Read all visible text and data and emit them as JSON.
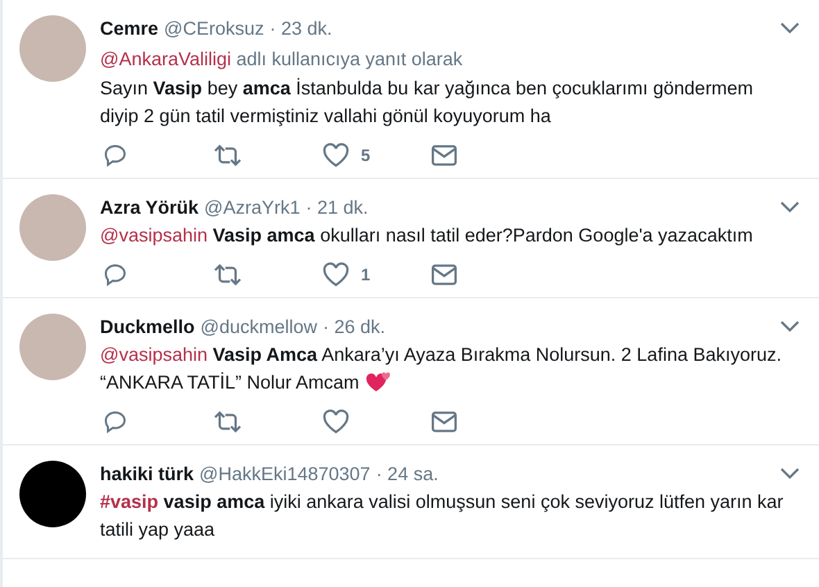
{
  "tweets": [
    {
      "name": "Cemre",
      "handle": "@CEroksuz",
      "time": "· 23 dk.",
      "reply_to": {
        "mention": "@AnkaraValiligi",
        "text": "adlı kullanıcıya yanıt olarak"
      },
      "text": "Sayın **Vasip** bey **amca** İstanbulda bu kar yağınca ben çocuklarımı göndermem diyip 2 gün tatil vermiştiniz vallahi gönül koyuyorum ha",
      "likes": "5",
      "actions": true
    },
    {
      "name": "Azra Yörük",
      "handle": "@AzraYrk1",
      "time": "· 21 dk.",
      "mention": "@vasipsahin",
      "text": "**Vasip amca** okulları nasıl tatil eder?Pardon Google'a yazacaktım",
      "likes": "1",
      "actions": true
    },
    {
      "name": "Duckmello",
      "handle": "@duckmellow",
      "time": "· 26 dk.",
      "mention": "@vasipsahin",
      "text": "**Vasip Amca** Ankara’yı Ayaza Bırakma Nolursun. 2 Lafina Bakıyoruz. “ANKARA TATİL” Nolur Amcam",
      "emoji_heart": true,
      "actions": true
    },
    {
      "name": "hakiki türk",
      "handle": "@HakkEki14870307",
      "time": "· 24 sa.",
      "mention": "#vasip",
      "text": "**vasip amca** iyiki ankara valisi olmuşsun seni çok seviyoruz lütfen yarın kar tatili yap yaaa",
      "actions": false
    }
  ]
}
